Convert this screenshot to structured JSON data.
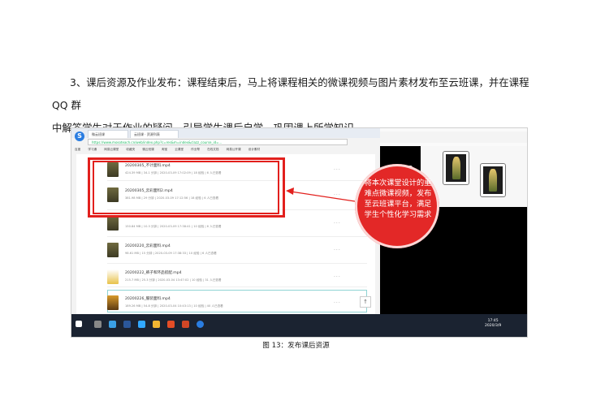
{
  "paragraph": {
    "line1": "3、课后资源及作业发布：课程结束后，马上将课程相关的微课视频与图片素材发布至云班课，并在课程 QQ 群",
    "line2": "中解答学生对于作业的疑问，引导学生课后自学，巩固课上所学知识。"
  },
  "browser": {
    "tab1": "微云班课",
    "tab2": "云班课 · 资源列表",
    "address": "https://www.mosoteach.cn/web/index.php?c=res&m=index&clazz_course_id=...",
    "bookmarks": [
      "百度",
      "学习通",
      "网易云课堂",
      "收藏夹",
      "微云班课",
      "淘宝",
      "云课堂",
      "作业帮",
      "在线文档",
      "网易公开课",
      "设计素材"
    ]
  },
  "files": [
    {
      "name": "20200305_不计面料.mp4",
      "meta": "424.39 MB  |  34.1 分钟  |  2020-03-09 17:02:09  |  18 经验  |  6 人已查看"
    },
    {
      "name": "20200305_云彩面料2.mp4",
      "meta": "381.98 MB  |  29 分钟  |  2020-03-09 17:12:56  |  18 经验  |  6 人已查看"
    },
    {
      "name": "",
      "meta": "150.84 MB  |  10.3 分钟  |  2020-03-09 17:38:41  |  10 经验  |  6 人已查看"
    },
    {
      "name": "20200220_云彩面料.mp4",
      "meta": "98.61 MB  |  15 分钟  |  2020-03-09 17:38:33  |  10 经验  |  6 人已查看"
    },
    {
      "name": "20200222_裤子和环品搭配.mp4",
      "meta": "215.7 MB  |  25.3 分钟  |  2020-03-04 13:47:02  |  10 经验  |  31 人已查看"
    },
    {
      "name": "20200226_服装面料.mp4",
      "meta": "189.26 MB  |  54.8 分钟  |  2020-03-04 10:43:13  |  10 经验  |  40 人已查看"
    }
  ],
  "more_glyph": "···",
  "callout": "将本次课堂设计的重难点微课视频，发布至云班课平台，满足学生个性化学习需求",
  "taskbar": {
    "time": "17:45",
    "date": "2020/3/9"
  },
  "caption": "图 13：发布课后资源",
  "colors": {
    "highlight": "#e2201d",
    "callout_bg": "#e32827",
    "taskbar": "#1b2331"
  }
}
